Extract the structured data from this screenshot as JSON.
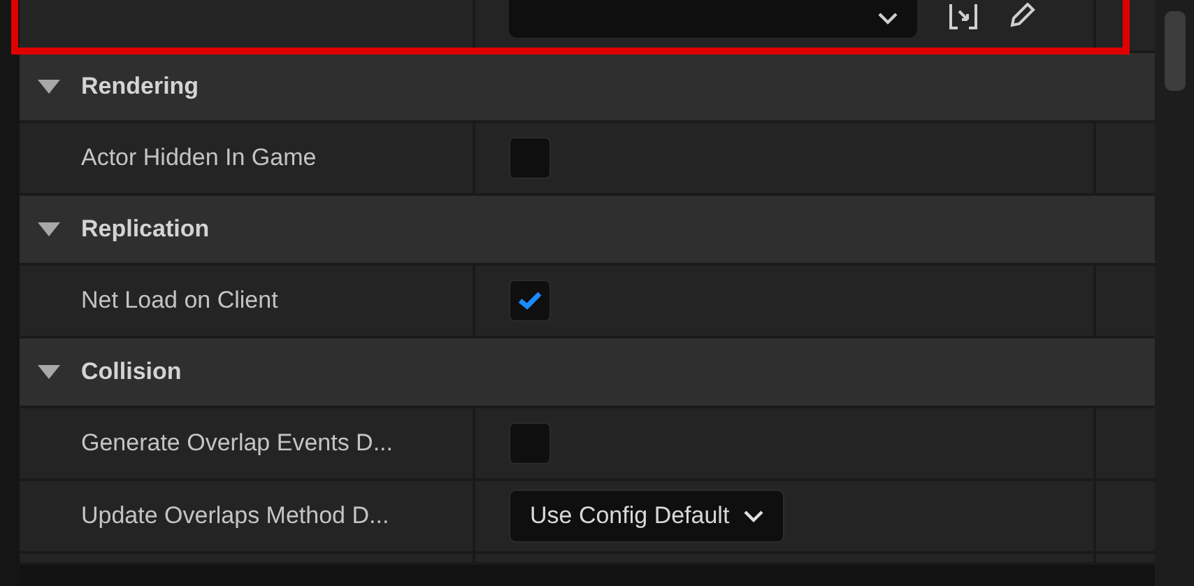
{
  "top_row": {
    "highlighted": true
  },
  "sections": [
    {
      "title": "Rendering",
      "expanded": true,
      "properties": [
        {
          "label": "Actor Hidden In Game",
          "kind": "checkbox",
          "checked": false
        }
      ]
    },
    {
      "title": "Replication",
      "expanded": true,
      "properties": [
        {
          "label": "Net Load on Client",
          "kind": "checkbox",
          "checked": true
        }
      ]
    },
    {
      "title": "Collision",
      "expanded": true,
      "properties": [
        {
          "label": "Generate Overlap Events D...",
          "kind": "checkbox",
          "checked": false
        },
        {
          "label": "Update Overlaps Method D...",
          "kind": "dropdown",
          "value": "Use Config Default"
        }
      ]
    }
  ]
}
